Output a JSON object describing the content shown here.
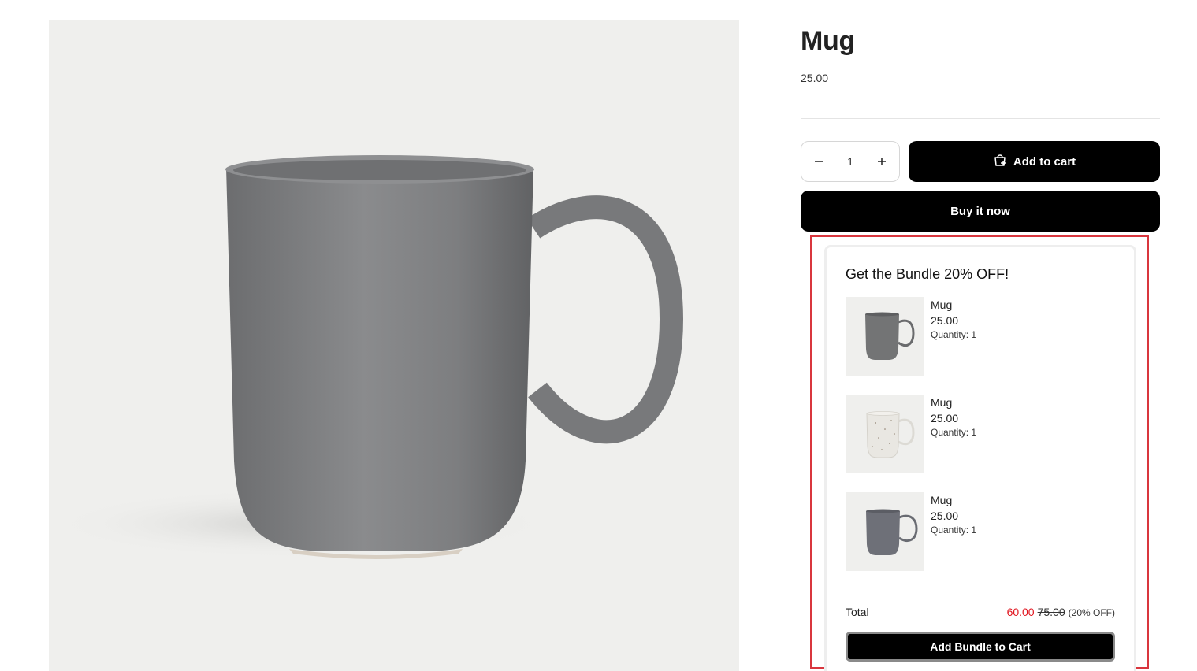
{
  "product": {
    "title": "Mug",
    "price": "25.00"
  },
  "purchase": {
    "quantity": "1",
    "minus_icon": "minus-icon",
    "plus_icon": "plus-icon",
    "add_to_cart_label": "Add to cart",
    "add_to_cart_icon": "cart-add-icon",
    "buy_now_label": "Buy it now"
  },
  "bundle": {
    "title": "Get the Bundle 20% OFF!",
    "items": [
      {
        "name": "Mug",
        "price": "25.00",
        "quantity": "Quantity: 1",
        "color": "#737475"
      },
      {
        "name": "Mug",
        "price": "25.00",
        "quantity": "Quantity: 1",
        "color": "#e9e7e2"
      },
      {
        "name": "Mug",
        "price": "25.00",
        "quantity": "Quantity: 1",
        "color": "#6e7078"
      }
    ],
    "total_label": "Total",
    "total_discounted": "60.00",
    "total_original": "75.00",
    "total_discount": "(20% OFF)",
    "add_button_label": "Add Bundle to Cart"
  },
  "colors": {
    "accent_button": "#000000",
    "discount_price": "#e0141e",
    "highlight_border": "#d9363e"
  }
}
